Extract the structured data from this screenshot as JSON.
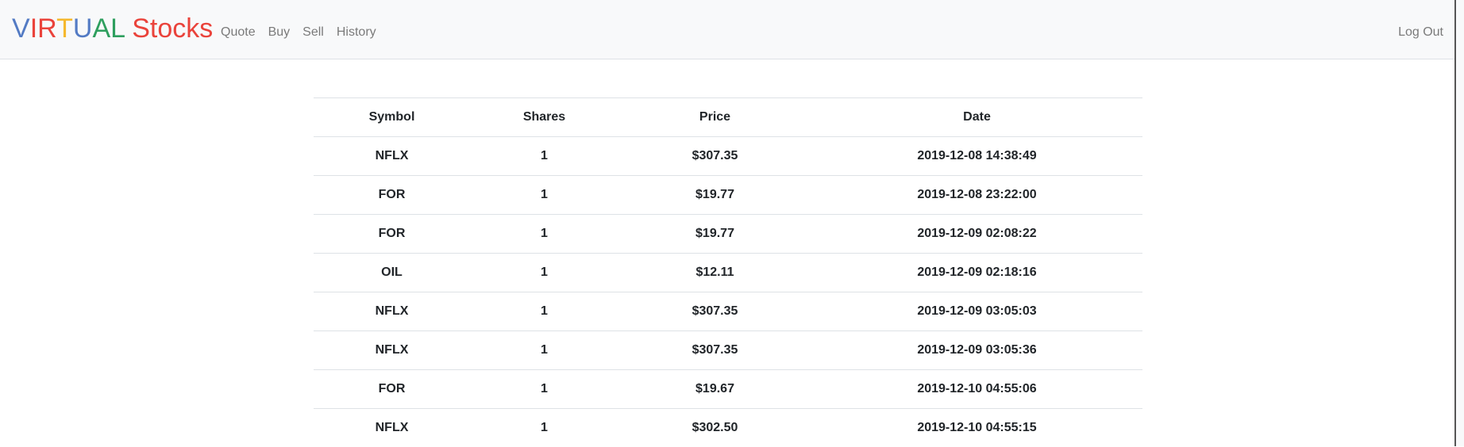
{
  "brand": {
    "letters": [
      {
        "char": "V",
        "color": "#537bc4"
      },
      {
        "char": "I",
        "color": "#ea433b"
      },
      {
        "char": "R",
        "color": "#ea433b"
      },
      {
        "char": "T",
        "color": "#f5b82e"
      },
      {
        "char": "U",
        "color": "#537bc4"
      },
      {
        "char": "A",
        "color": "#2e9f5e"
      },
      {
        "char": "L",
        "color": "#2e9f5e"
      }
    ],
    "word2": "Stocks"
  },
  "nav": {
    "quote": "Quote",
    "buy": "Buy",
    "sell": "Sell",
    "history": "History",
    "logout": "Log Out"
  },
  "table": {
    "headers": [
      "Symbol",
      "Shares",
      "Price",
      "Date"
    ],
    "rows": [
      [
        "NFLX",
        "1",
        "$307.35",
        "2019-12-08 14:38:49"
      ],
      [
        "FOR",
        "1",
        "$19.77",
        "2019-12-08 23:22:00"
      ],
      [
        "FOR",
        "1",
        "$19.77",
        "2019-12-09 02:08:22"
      ],
      [
        "OIL",
        "1",
        "$12.11",
        "2019-12-09 02:18:16"
      ],
      [
        "NFLX",
        "1",
        "$307.35",
        "2019-12-09 03:05:03"
      ],
      [
        "NFLX",
        "1",
        "$307.35",
        "2019-12-09 03:05:36"
      ],
      [
        "FOR",
        "1",
        "$19.67",
        "2019-12-10 04:55:06"
      ],
      [
        "NFLX",
        "1",
        "$302.50",
        "2019-12-10 04:55:15"
      ]
    ]
  }
}
